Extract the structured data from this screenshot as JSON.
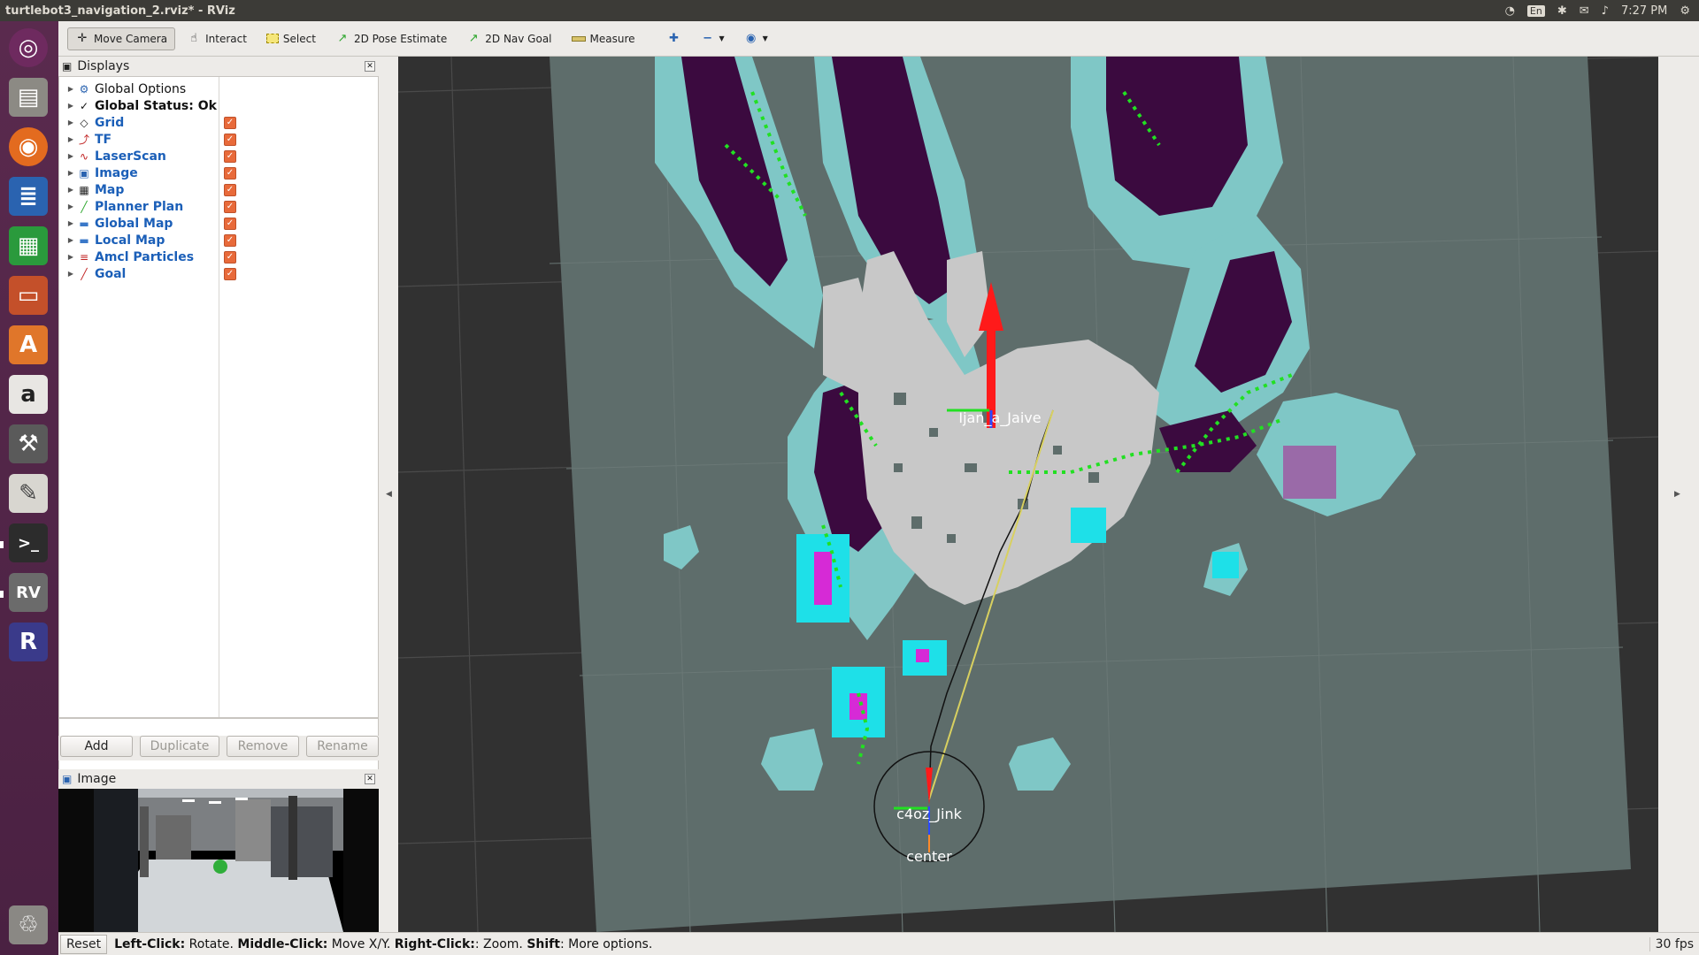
{
  "window": {
    "title": "turtlebot3_navigation_2.rviz* - RViz"
  },
  "system_tray": {
    "lang": "En",
    "time": "7:27 PM"
  },
  "toolbar": {
    "tools": [
      {
        "label": "Move Camera",
        "icon": "move-camera-icon",
        "active": true
      },
      {
        "label": "Interact",
        "icon": "hand-icon"
      },
      {
        "label": "Select",
        "icon": "select-box-icon"
      },
      {
        "label": "2D Pose Estimate",
        "icon": "green-arrow-icon"
      },
      {
        "label": "2D Nav Goal",
        "icon": "green-arrow-icon"
      },
      {
        "label": "Measure",
        "icon": "ruler-icon"
      }
    ]
  },
  "displays": {
    "title": "Displays",
    "items": [
      {
        "label": "Global Options",
        "icon": "gear-icon",
        "style": "plain",
        "checked": null
      },
      {
        "label": "Global Status: Ok",
        "icon": "check-icon",
        "style": "status",
        "checked": null
      },
      {
        "label": "Grid",
        "icon": "grid-icon",
        "style": "link",
        "checked": true
      },
      {
        "label": "TF",
        "icon": "tf-icon",
        "style": "link",
        "checked": true
      },
      {
        "label": "LaserScan",
        "icon": "laserscan-icon",
        "style": "link",
        "checked": true
      },
      {
        "label": "Image",
        "icon": "image-icon",
        "style": "link",
        "checked": true
      },
      {
        "label": "Map",
        "icon": "map-icon",
        "style": "link",
        "checked": true
      },
      {
        "label": "Planner Plan",
        "icon": "path-icon",
        "style": "link",
        "checked": true
      },
      {
        "label": "Global Map",
        "icon": "folder-icon",
        "style": "link",
        "checked": true
      },
      {
        "label": "Local Map",
        "icon": "folder-icon",
        "style": "link",
        "checked": true
      },
      {
        "label": "Amcl Particles",
        "icon": "particles-icon",
        "style": "link",
        "checked": true
      },
      {
        "label": "Goal",
        "icon": "goal-icon",
        "style": "link",
        "checked": true
      }
    ],
    "buttons": {
      "add": "Add",
      "duplicate": "Duplicate",
      "remove": "Remove",
      "rename": "Rename"
    }
  },
  "image_panel": {
    "title": "Image"
  },
  "viewport": {
    "labels": {
      "goal": "Ijan_a_Jaive",
      "robot": "c4oz_Jink",
      "center": "center"
    }
  },
  "statusbar": {
    "reset": "Reset",
    "help_parts": [
      {
        "bold": "Left-Click:",
        "text": " Rotate. "
      },
      {
        "bold": "Middle-Click:",
        "text": " Move X/Y. "
      },
      {
        "bold": "Right-Click:",
        "text": ": Zoom. "
      },
      {
        "bold": "Shift",
        "text": ": More options."
      }
    ],
    "fps": "30 fps"
  },
  "colors": {
    "accent": "#e86a3a",
    "link": "#1b5fb8",
    "map_bg": "#5e6d6b",
    "occupied": "#3b0a3f",
    "inflation": "#7fc7c6"
  }
}
